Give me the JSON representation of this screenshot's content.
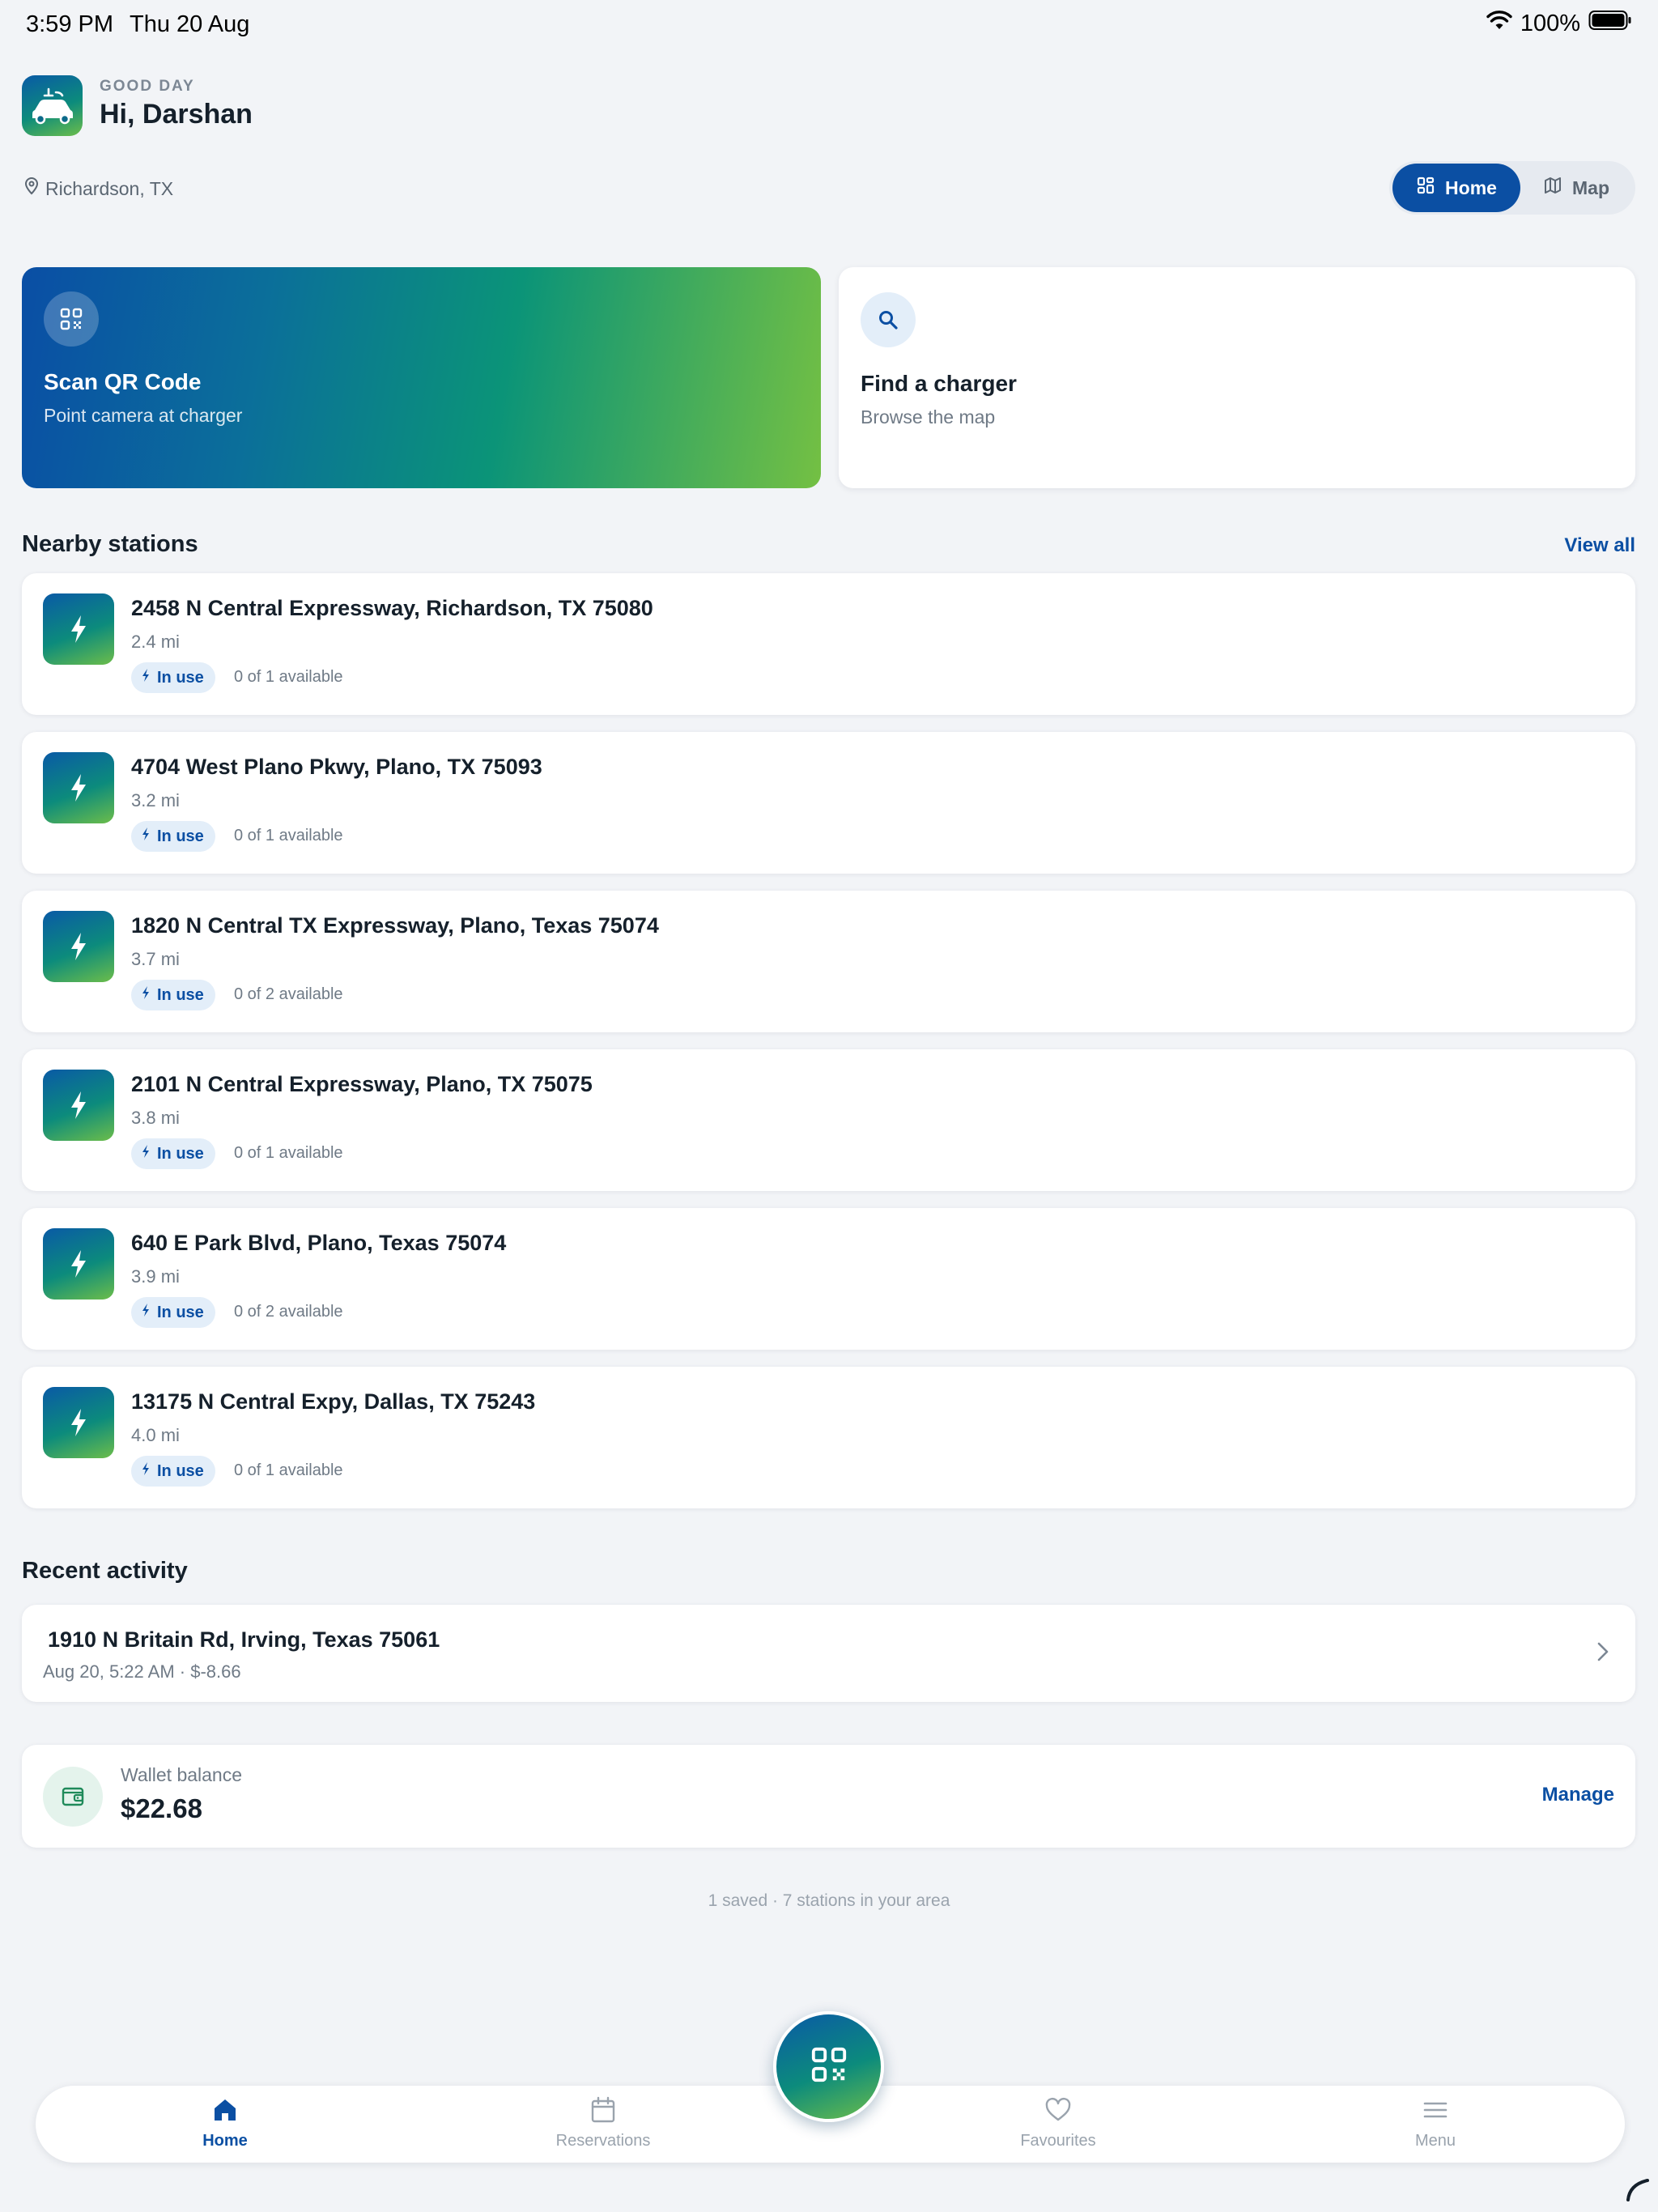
{
  "status_bar": {
    "time": "3:59 PM",
    "date": "Thu 20 Aug",
    "battery": "100%"
  },
  "header": {
    "greeting": "GOOD DAY",
    "hello": "Hi, Darshan",
    "location": "Richardson, TX"
  },
  "view_toggle": {
    "home_label": "Home",
    "map_label": "Map",
    "selected": "Home"
  },
  "actions": {
    "scan": {
      "title": "Scan QR Code",
      "subtitle": "Point camera at charger",
      "icon": "qr-code-icon"
    },
    "find": {
      "title": "Find a charger",
      "subtitle": "Browse the map",
      "icon": "search-icon"
    }
  },
  "nearby": {
    "title": "Nearby stations",
    "view_all": "View all",
    "stations": [
      {
        "address": "2458 N Central Expressway, Richardson, TX 75080",
        "distance": "2.4 mi",
        "status": "In use",
        "availability": "0 of 1 available"
      },
      {
        "address": "4704 West Plano Pkwy, Plano, TX 75093",
        "distance": "3.2 mi",
        "status": "In use",
        "availability": "0 of 1 available"
      },
      {
        "address": "1820 N Central TX Expressway, Plano, Texas 75074",
        "distance": "3.7 mi",
        "status": "In use",
        "availability": "0 of 2 available"
      },
      {
        "address": "2101 N Central Expressway, Plano, TX 75075",
        "distance": "3.8 mi",
        "status": "In use",
        "availability": "0 of 1 available"
      },
      {
        "address": "640 E Park Blvd, Plano, Texas 75074",
        "distance": "3.9 mi",
        "status": "In use",
        "availability": "0 of 2 available"
      },
      {
        "address": "13175 N Central Expy, Dallas, TX 75243",
        "distance": "4.0 mi",
        "status": "In use",
        "availability": "0 of 1 available"
      }
    ]
  },
  "recent": {
    "title": "Recent activity",
    "item": {
      "address": "1910 N Britain Rd, Irving, Texas 75061",
      "meta": "Aug 20, 5:22 AM  ·  $-8.66"
    }
  },
  "wallet": {
    "label": "Wallet balance",
    "value": "$22.68",
    "action": "Manage"
  },
  "footer_note": "1 saved  ·  7 stations in your area",
  "bottom_nav": {
    "items": [
      {
        "label": "Home",
        "icon": "home-icon",
        "active": true
      },
      {
        "label": "Reservations",
        "icon": "calendar-icon",
        "active": false
      },
      {
        "label": "Favourites",
        "icon": "heart-icon",
        "active": false
      },
      {
        "label": "Menu",
        "icon": "menu-icon",
        "active": false
      }
    ]
  },
  "colors": {
    "primary": "#0b4fa3",
    "accent_green": "#6cbd4a",
    "teal": "#0c8b7c",
    "background": "#f2f4f7"
  }
}
